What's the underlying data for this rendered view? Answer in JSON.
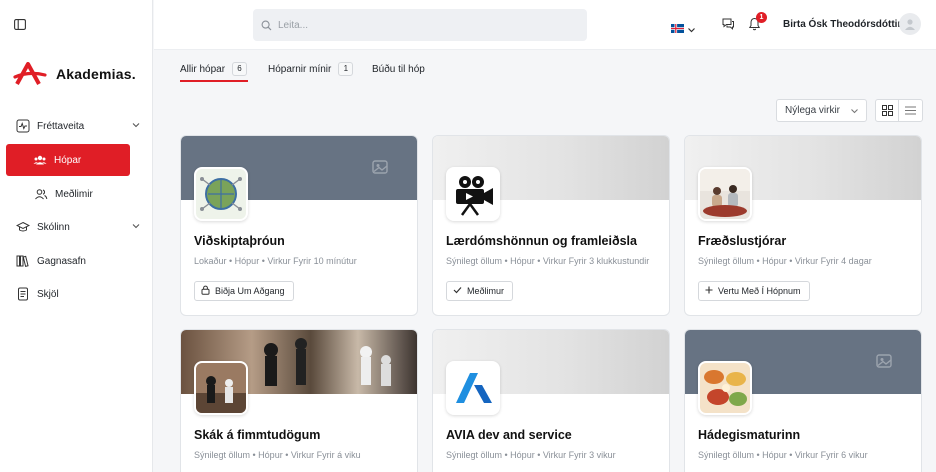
{
  "app": {
    "brand": "Akademias."
  },
  "sidebar": {
    "items": [
      {
        "label": "Fréttaveita",
        "icon": "activity-icon",
        "has_children": true
      },
      {
        "label": "Hópar",
        "icon": "users-icon",
        "active": true
      },
      {
        "label": "Meðlimir",
        "icon": "members-icon"
      },
      {
        "label": "Skólinn",
        "icon": "graduation-cap-icon",
        "has_children": true
      },
      {
        "label": "Gagnasafn",
        "icon": "library-icon"
      },
      {
        "label": "Skjöl",
        "icon": "document-icon"
      }
    ]
  },
  "topbar": {
    "search_placeholder": "Leita...",
    "language_flag": "iceland-flag-icon",
    "notification_count": "1",
    "user_name": "Birta Ósk Theodórsdóttir"
  },
  "tabs": [
    {
      "label": "Allir hópar",
      "count": "6",
      "active": true
    },
    {
      "label": "Hóparnir mínir",
      "count": "1"
    },
    {
      "label": "Búðu til hóp",
      "count": null
    }
  ],
  "controls": {
    "sort_label": "Nýlega virkir",
    "views": [
      "grid-view-icon",
      "list-view-icon"
    ]
  },
  "groups": [
    {
      "title": "Viðskiptaþróun",
      "meta": "Lokaður • Hópur • Virkur Fyrir 10 mínútur",
      "action": "Biðja Um Aðgang",
      "action_icon": "lock-icon",
      "cover": "slate",
      "thumb": "globe-circuit-image"
    },
    {
      "title": "Lærdómshönnun og framleiðsla",
      "meta": "Sýnilegt öllum • Hópur • Virkur Fyrir 3 klukkustundir",
      "action": "Meðlimur",
      "action_icon": "check-icon",
      "cover": "light",
      "thumb": "movie-camera-icon"
    },
    {
      "title": "Fræðslustjórar",
      "meta": "Sýnilegt öllum • Hópur • Virkur Fyrir 4 dagar",
      "action": "Vertu Með Í Hópnum",
      "action_icon": "plus-icon",
      "cover": "light",
      "thumb": "meeting-photo"
    },
    {
      "title": "Skák á fimmtudögum",
      "meta": "Sýnilegt öllum • Hópur • Virkur Fyrir á viku",
      "action": "",
      "action_icon": "",
      "cover": "chess",
      "thumb": "chess-photo"
    },
    {
      "title": "AVIA dev and service",
      "meta": "Sýnilegt öllum • Hópur • Virkur Fyrir 3 vikur",
      "action": "",
      "action_icon": "",
      "cover": "light",
      "thumb": "avia-logo"
    },
    {
      "title": "Hádegismaturinn",
      "meta": "Sýnilegt öllum • Hópur • Virkur Fyrir 6 vikur",
      "action": "",
      "action_icon": "",
      "cover": "slate",
      "thumb": "food-photo"
    }
  ],
  "colors": {
    "accent": "#e01e26",
    "cover_slate": "#677383",
    "page_bg": "#f5f6f8"
  }
}
